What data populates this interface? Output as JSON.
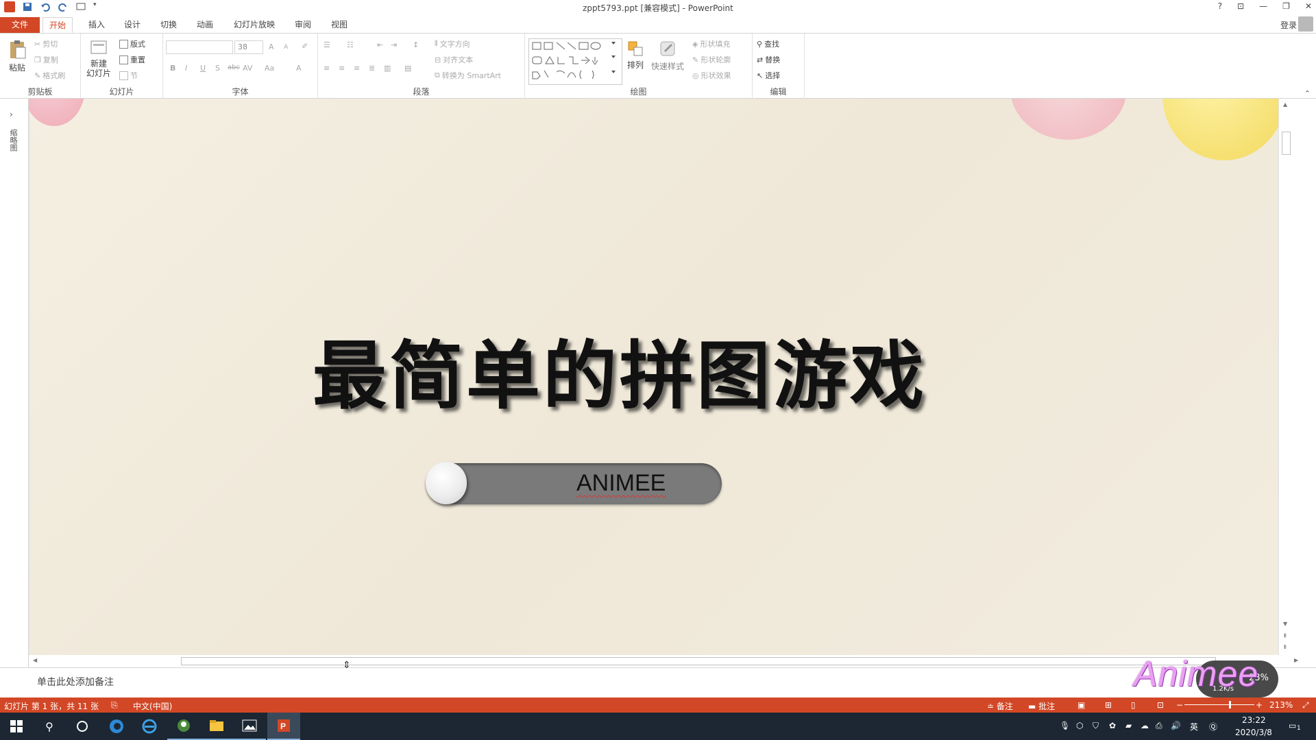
{
  "window": {
    "title": "zppt5793.ppt [兼容模式] - PowerPoint",
    "help": "?",
    "login": "登录"
  },
  "tabs": [
    "文件",
    "开始",
    "插入",
    "设计",
    "切换",
    "动画",
    "幻灯片放映",
    "审阅",
    "视图"
  ],
  "ribbon": {
    "clipboard": {
      "label": "剪贴板",
      "paste": "粘贴",
      "cut": "剪切",
      "copy": "复制",
      "format_painter": "格式刷"
    },
    "slides": {
      "label": "幻灯片",
      "new_slide_1": "新建",
      "new_slide_2": "幻灯片",
      "layout": "版式",
      "reset": "重置",
      "section": "节"
    },
    "font": {
      "label": "字体",
      "size": "38",
      "grow": "A",
      "shrink": "A",
      "bold": "B",
      "italic": "I",
      "underline": "U",
      "shadow": "S",
      "strike": "abc",
      "spacing": "AV",
      "case": "Aa",
      "color": "A"
    },
    "paragraph": {
      "label": "段落",
      "text_direction": "文字方向",
      "align_text": "对齐文本",
      "smartart": "转换为 SmartArt"
    },
    "drawing": {
      "label": "绘图",
      "arrange": "排列",
      "quick_styles": "快速样式",
      "shape_fill": "形状填充",
      "shape_outline": "形状轮廓",
      "shape_effects": "形状效果"
    },
    "editing": {
      "label": "编辑",
      "find": "查找",
      "replace": "替换",
      "select": "选择"
    }
  },
  "left_pane": {
    "label": "缩略图"
  },
  "slide": {
    "title": "最简单的拼图游戏",
    "toggle_label": "ANIMEE"
  },
  "notes": {
    "placeholder": "单击此处添加备注"
  },
  "watermark": {
    "text": "Animee",
    "speed": "1.2K/s",
    "percent": "23%"
  },
  "status": {
    "slide_info": "幻灯片 第 1 张，共 11 张",
    "language": "中文(中国)",
    "notes_btn": "备注",
    "comments_btn": "批注",
    "zoom": "213%"
  },
  "taskbar": {
    "time": "23:22",
    "date": "2020/3/8",
    "ime": "英",
    "notif_count": "1"
  },
  "colors": {
    "accent": "#d24726",
    "taskbar": "#1c2733"
  }
}
